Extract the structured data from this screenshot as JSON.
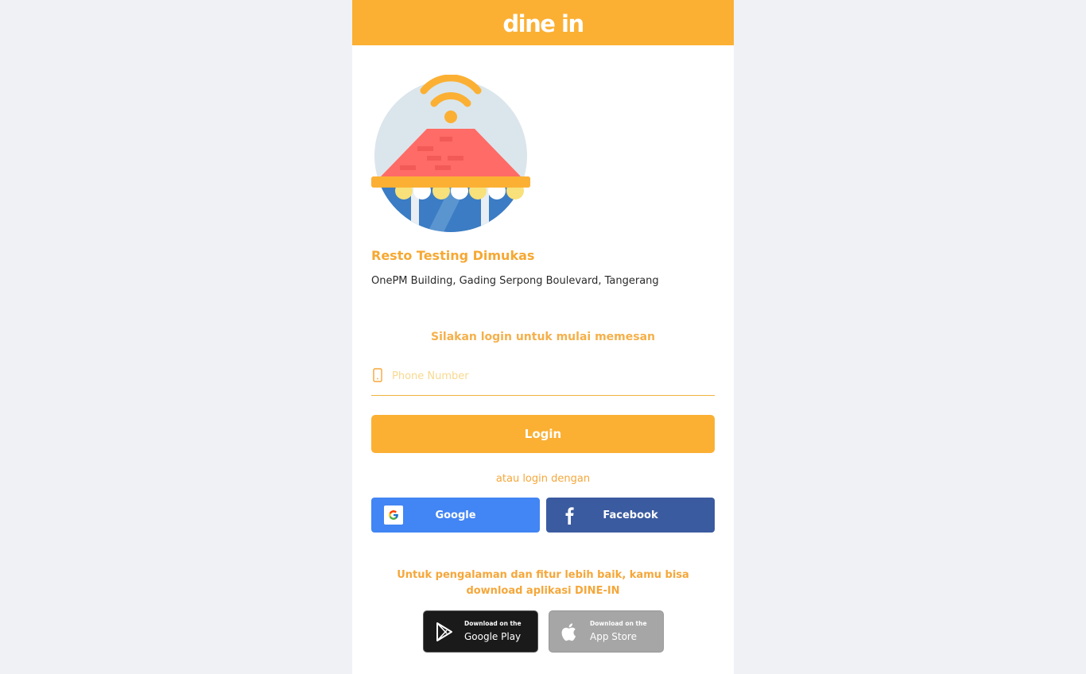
{
  "header": {
    "logo_text": "dine in"
  },
  "restaurant": {
    "name": "Resto Testing Dimukas",
    "address": "OnePM Building, Gading Serpong Boulevard, Tangerang",
    "illustration": "restaurant-wifi-illustration"
  },
  "login": {
    "prompt": "Silakan login untuk mulai memesan",
    "phone_placeholder": "Phone Number",
    "phone_value": "",
    "phone_icon": "smartphone-icon",
    "login_label": "Login",
    "alt_text": "atau login dengan",
    "google_label": "Google",
    "facebook_label": "Facebook"
  },
  "download": {
    "text": "Untuk pengalaman dan fitur lebih baik, kamu bisa download aplikasi DINE-IN",
    "google_play": {
      "small": "Download on the",
      "big": "Google Play"
    },
    "app_store": {
      "small": "Download on the",
      "big": "App Store"
    }
  },
  "colors": {
    "brand": "#fbb033",
    "google": "#4285f4",
    "facebook": "#3b5ba0",
    "background": "#eff1f5"
  }
}
